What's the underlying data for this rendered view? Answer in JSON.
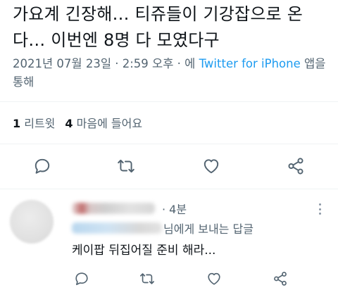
{
  "tweet": {
    "text": "가요계 긴장해… 티쥬들이 기강잡으로 온다… 이번엔 8명 다 모였다구",
    "date": "2021년 07월 23일 · 2:59 오후 · 에",
    "via": "Twitter for iPhone",
    "via_suffix": "앱을 통해"
  },
  "stats": {
    "retweets_count": "1",
    "retweets_label": "리트윗",
    "likes_count": "4",
    "likes_label": "마음에 들어요"
  },
  "actions": {
    "icons": [
      "reply-icon",
      "retweet-icon",
      "like-icon",
      "share-icon"
    ]
  },
  "reply": {
    "time": "· 4분",
    "reply_to_suffix": "님에게 보내는 답글",
    "text": "케이팝 뒤집어질 준비 해라..."
  },
  "colors": {
    "text": "#0f1419",
    "secondary": "#536471",
    "link": "#1d9bf0",
    "divider": "#eff3f4"
  }
}
